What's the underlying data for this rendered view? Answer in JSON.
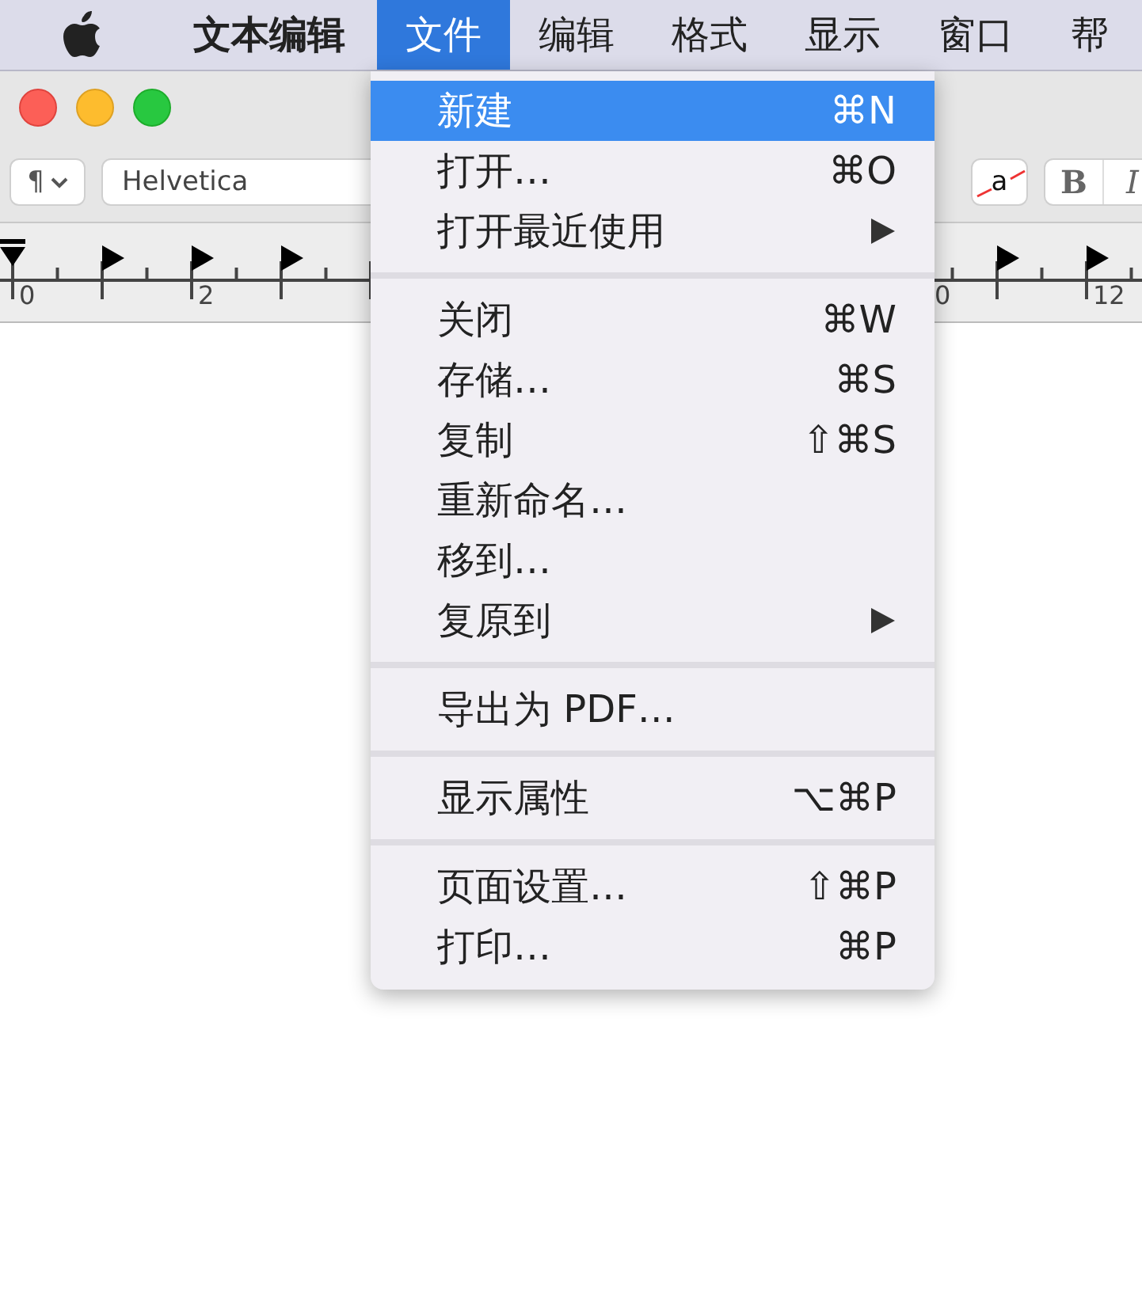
{
  "menu_bar": {
    "items": [
      {
        "label": "文本编辑",
        "kind": "app",
        "selected": false
      },
      {
        "label": "文件",
        "kind": "menu",
        "selected": true
      },
      {
        "label": "编辑",
        "kind": "menu",
        "selected": false
      },
      {
        "label": "格式",
        "kind": "menu",
        "selected": false
      },
      {
        "label": "显示",
        "kind": "menu",
        "selected": false
      },
      {
        "label": "窗口",
        "kind": "menu",
        "selected": false
      },
      {
        "label": "帮",
        "kind": "menu",
        "selected": false
      }
    ]
  },
  "toolbar": {
    "paragraph_button": "¶",
    "font_field": "Helvetica",
    "text_color_button": "a",
    "bold_button": "B",
    "italic_button": "I"
  },
  "ruler": {
    "labels": [
      "0",
      "2",
      "0",
      "12"
    ]
  },
  "file_menu": {
    "sections": [
      [
        {
          "label": "新建",
          "shortcut": "⌘N",
          "submenu": false,
          "selected": true
        },
        {
          "label": "打开…",
          "shortcut": "⌘O",
          "submenu": false,
          "selected": false
        },
        {
          "label": "打开最近使用",
          "submenu": true,
          "selected": false
        }
      ],
      [
        {
          "label": "关闭",
          "shortcut": "⌘W",
          "submenu": false,
          "selected": false
        },
        {
          "label": "存储…",
          "shortcut": "⌘S",
          "submenu": false,
          "selected": false
        },
        {
          "label": "复制",
          "shortcut": "⇧⌘S",
          "submenu": false,
          "selected": false
        },
        {
          "label": "重新命名…",
          "submenu": false,
          "selected": false
        },
        {
          "label": "移到…",
          "submenu": false,
          "selected": false
        },
        {
          "label": "复原到",
          "submenu": true,
          "selected": false
        }
      ],
      [
        {
          "label": "导出为 PDF…",
          "submenu": false,
          "selected": false
        }
      ],
      [
        {
          "label": "显示属性",
          "shortcut": "⌥⌘P",
          "submenu": false,
          "selected": false
        }
      ],
      [
        {
          "label": "页面设置…",
          "shortcut": "⇧⌘P",
          "submenu": false,
          "selected": false
        },
        {
          "label": "打印…",
          "shortcut": "⌘P",
          "submenu": false,
          "selected": false
        }
      ]
    ]
  }
}
